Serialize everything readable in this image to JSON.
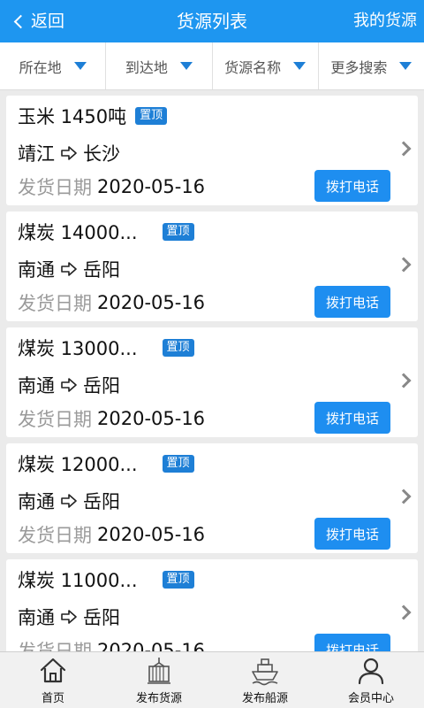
{
  "header": {
    "back_label": "返回",
    "title": "货源列表",
    "right_label": "我的货源"
  },
  "filters": [
    {
      "label": "所在地"
    },
    {
      "label": "到达地"
    },
    {
      "label": "货源名称"
    },
    {
      "label": "更多搜索"
    }
  ],
  "list": {
    "date_label": "发货日期",
    "call_label": "拨打电话",
    "badge_label": "置顶",
    "items": [
      {
        "name": "玉米 1450吨",
        "from": "靖江",
        "to": "长沙",
        "date": "2020-05-16"
      },
      {
        "name": "煤炭 14000...",
        "from": "南通",
        "to": "岳阳",
        "date": "2020-05-16"
      },
      {
        "name": "煤炭 13000...",
        "from": "南通",
        "to": "岳阳",
        "date": "2020-05-16"
      },
      {
        "name": "煤炭 12000...",
        "from": "南通",
        "to": "岳阳",
        "date": "2020-05-16"
      },
      {
        "name": "煤炭 11000...",
        "from": "南通",
        "to": "岳阳",
        "date": "2020-05-16"
      }
    ]
  },
  "tabbar": [
    {
      "label": "首页",
      "icon": "home-icon"
    },
    {
      "label": "发布货源",
      "icon": "cargo-icon"
    },
    {
      "label": "发布船源",
      "icon": "ship-icon"
    },
    {
      "label": "会员中心",
      "icon": "user-icon"
    }
  ],
  "colors": {
    "primary": "#1e96f0",
    "badge": "#1e7fd6",
    "button": "#1e8ef0"
  }
}
